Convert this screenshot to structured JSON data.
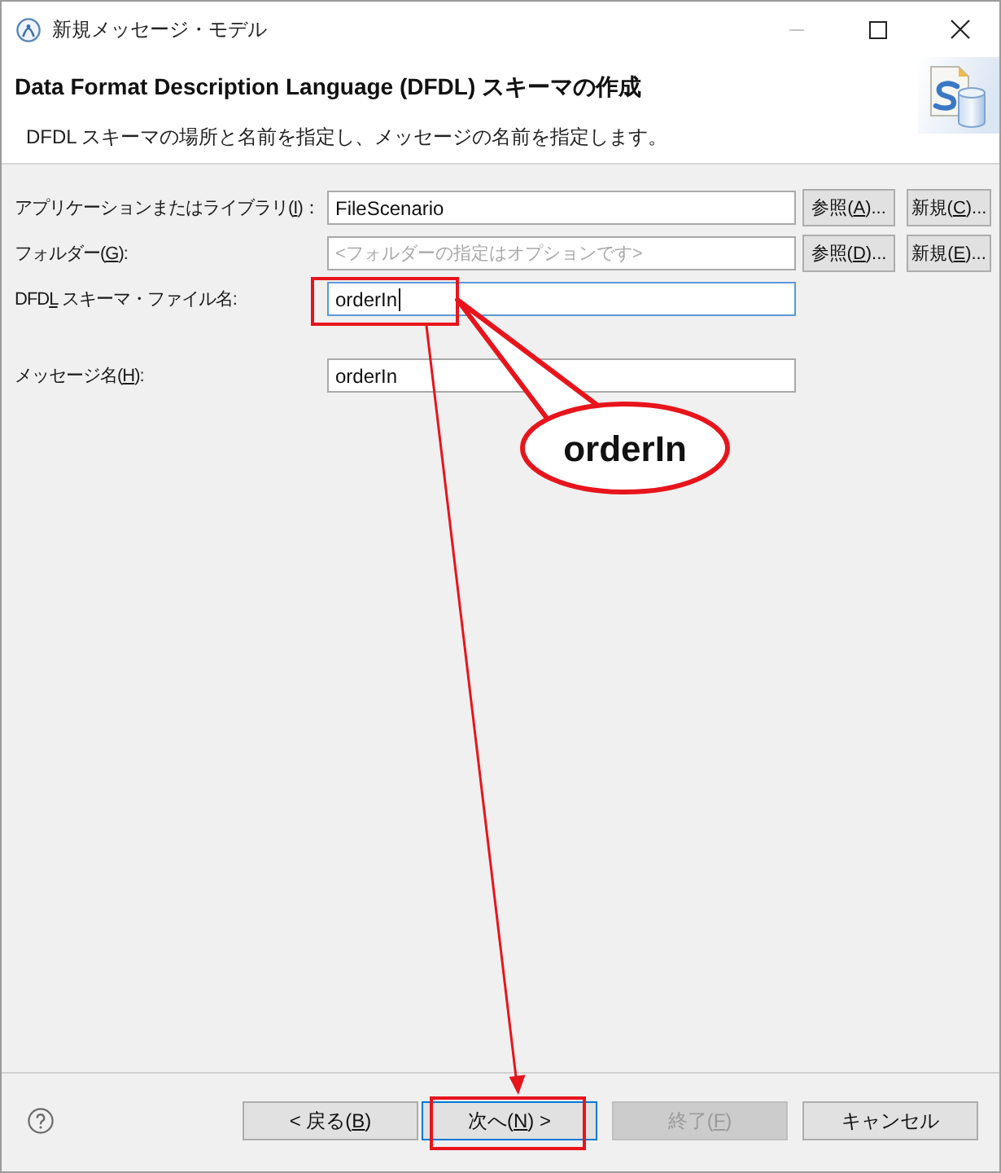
{
  "window": {
    "title": "新規メッセージ・モデル"
  },
  "header": {
    "title": "Data Format Description Language (DFDL) スキーマの作成",
    "description": "DFDL スキーマの場所と名前を指定し、メッセージの名前を指定します。"
  },
  "form": {
    "fields": [
      {
        "label": {
          "before": "アプリケーションまたはライブラリ(",
          "key": "I",
          "after": ")："
        },
        "value": "FileScenario",
        "focused": false,
        "buttons": [
          {
            "label": {
              "before": "参照(",
              "key": "A",
              "after": ")..."
            }
          },
          {
            "label": {
              "before": "新規(",
              "key": "C",
              "after": ")..."
            }
          }
        ]
      },
      {
        "label": {
          "before": "フォルダー(",
          "key": "G",
          "after": "):"
        },
        "placeholder": "<フォルダーの指定はオプションです>",
        "focused": false,
        "buttons": [
          {
            "label": {
              "before": "参照(",
              "key": "D",
              "after": ")..."
            }
          },
          {
            "label": {
              "before": "新規(",
              "key": "E",
              "after": ")..."
            }
          }
        ]
      },
      {
        "label": {
          "before": "DFD",
          "key": "L",
          "after": " スキーマ・ファイル名:"
        },
        "value": "orderIn",
        "focused": true
      },
      {
        "label": {
          "before": "メッセージ名(",
          "key": "H",
          "after": "):"
        },
        "value": "orderIn",
        "focused": false
      }
    ]
  },
  "annotation": {
    "callout": "orderIn"
  },
  "footer": {
    "buttons": [
      {
        "label": {
          "before": "< 戻る(",
          "key": "B",
          "after": ")"
        },
        "default": false,
        "disabled": false
      },
      {
        "label": {
          "before": "次へ(",
          "key": "N",
          "after": ") >"
        },
        "default": true,
        "disabled": false
      },
      {
        "label": {
          "before": "終了(",
          "key": "F",
          "after": ")"
        },
        "default": false,
        "disabled": true
      },
      {
        "label": {
          "before": "キャンセル"
        },
        "default": false,
        "disabled": false
      }
    ]
  }
}
